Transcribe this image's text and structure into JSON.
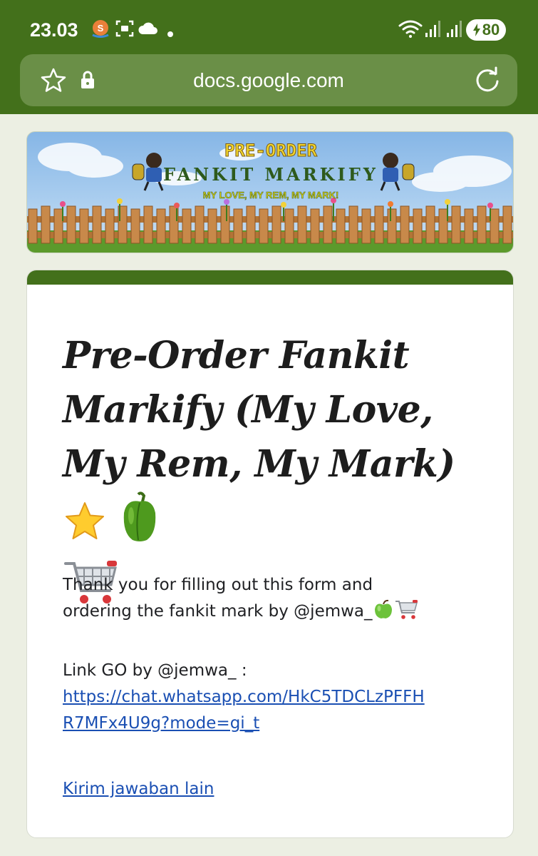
{
  "status_bar": {
    "time": "23.03",
    "battery": "80"
  },
  "browser": {
    "url": "docs.google.com"
  },
  "banner": {
    "line1": "PRE-ORDER",
    "line2": "FANKIT MARKIFY",
    "line3": "MY LOVE, MY REM, MY MARK!"
  },
  "form": {
    "title": "Pre-Order Fankit Markify (My Love, My Rem, My Mark)",
    "description_line1": "Thank you for filling out this form and",
    "description_line2": "ordering the fankit mark by @jemwa_",
    "link_label": "Link GO by @jemwa_ :",
    "link_line1": "https://chat.whatsapp.com/HkC5TDCLzPFFH",
    "link_line2": "R7MFx4U9g?mode=gi_t",
    "submit_another": "Kirim jawaban lain"
  },
  "colors": {
    "theme_green": "#43701b",
    "url_bar": "#6a8f47",
    "background": "#ecefe3",
    "link": "#1a4fb3"
  },
  "icons": [
    "star-icon",
    "lock-icon",
    "reload-icon",
    "wifi-icon",
    "signal-icon",
    "cloud-icon",
    "screenshot-icon",
    "notification-app-icon",
    "star-emoji",
    "bell-pepper-emoji",
    "shopping-cart-emoji",
    "green-apple-emoji"
  ]
}
